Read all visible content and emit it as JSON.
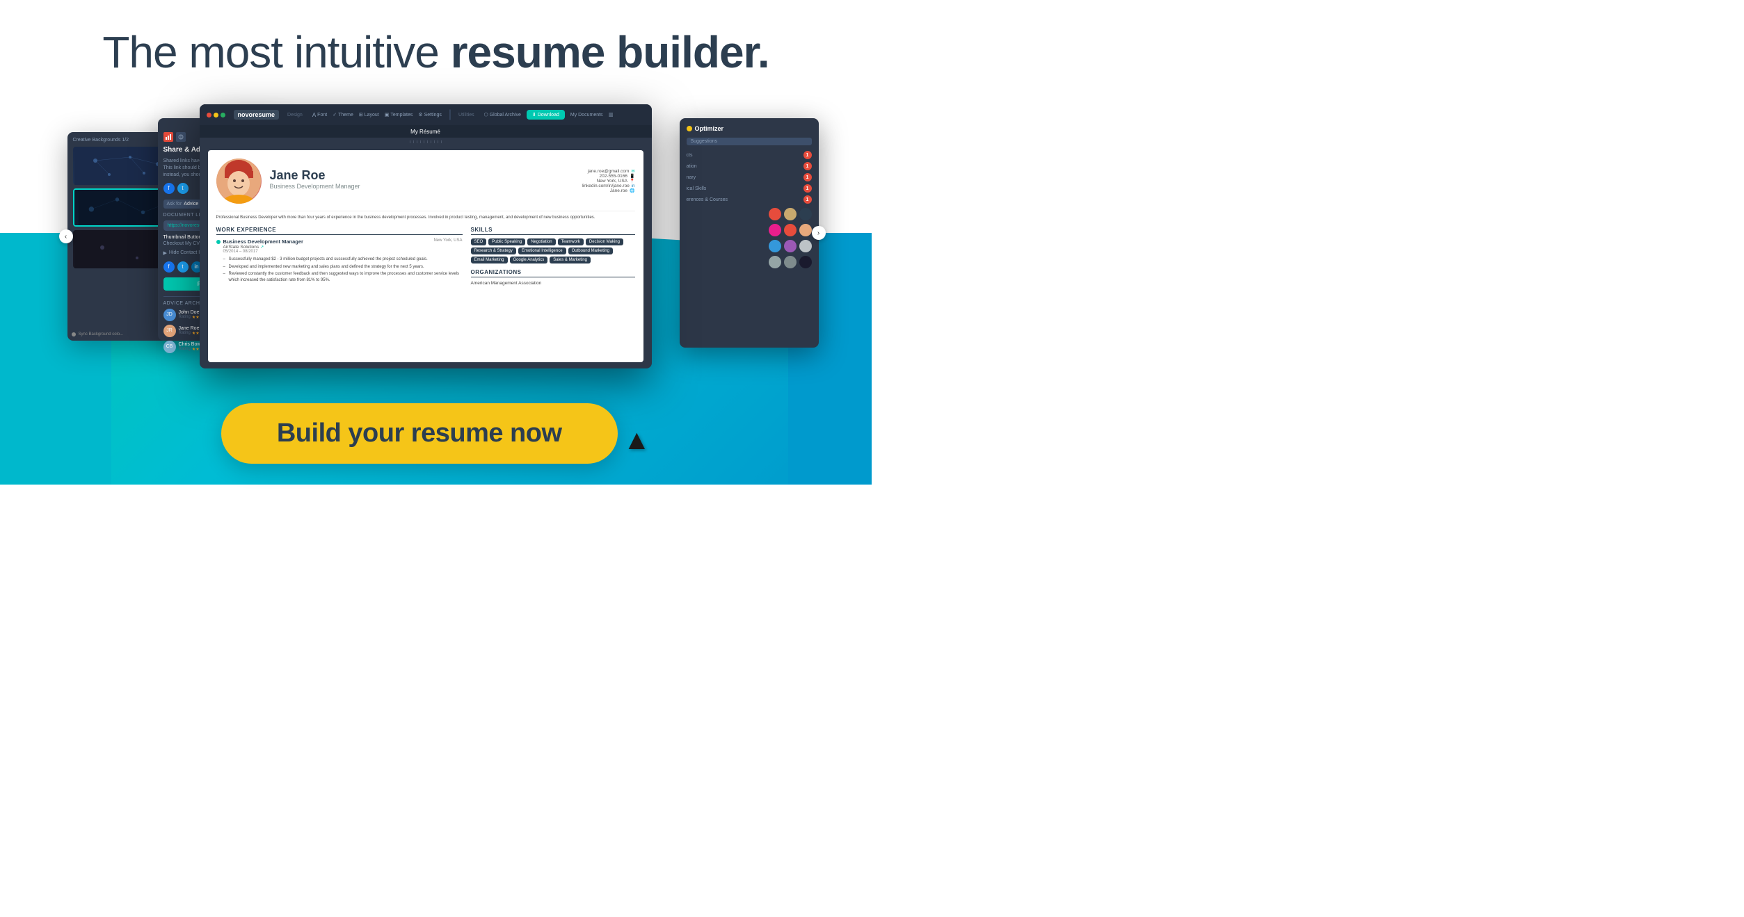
{
  "headline": {
    "part1": "The most intuitive ",
    "part2": "resume builder."
  },
  "cta": {
    "button_label": "Build your resume now"
  },
  "toolbar": {
    "logo": "novoresume",
    "design_label": "Design",
    "utilities_label": "Utilities",
    "font_label": "Font",
    "theme_label": "Theme",
    "layout_label": "Layout",
    "templates_label": "Templates",
    "settings_label": "Settings",
    "global_archive_label": "Global Archive",
    "download_label": "Download",
    "my_documents_label": "My Documents",
    "document_title": "My Résumé"
  },
  "resume": {
    "name": "Jane Roe",
    "title": "Business Development Manager",
    "email": "jane.roe@gmail.com",
    "phone": "202-555-0166",
    "location": "New York, USA",
    "linkedin": "linkedin.com/in/jane.roe",
    "portfolio": "Jane.roe",
    "summary": "Professional Business Developer with more than four years of experience in the business development processes. Involved in product testing, management, and development of new business opportunities.",
    "work_experience_label": "WORK EXPERIENCE",
    "skills_label": "SKILLS",
    "organizations_label": "ORGANIZATIONS",
    "job": {
      "title": "Business Development Manager",
      "company": "AirState Solutions",
      "dates": "05/2014 – 08/2017",
      "location": "New York, USA",
      "bullets": [
        "Successfully managed $2 - 3 million budget projects and successfully achieved the project scheduled goals.",
        "Developed and implemented new marketing and sales plans and defined the strategy for the next 5 years.",
        "Reviewed constantly the customer feedback and then suggested ways to improve the processes and customer service levels which increased the satisfaction rate from 81% to 95%."
      ]
    },
    "skills": [
      "SEO",
      "Public Speaking",
      "Negotiation",
      "Teamwork",
      "Decision Making",
      "Research & Strategy",
      "Emotional Intelligence",
      "Outbound Marketing",
      "Email Marketing",
      "Google Analytics",
      "Sales & Marketing"
    ],
    "org": "American Management Association"
  },
  "share_panel": {
    "title": "Share & Advice",
    "note1": "Shared links have no automatic upd...",
    "note2": "This link should be shared with spe...",
    "note3": "instead, you should be the PDF...",
    "document_link_label": "Document Link",
    "link_value": "https://novoresume.com/refler-m...",
    "thumbnail_label": "Thumbnail Button Text",
    "thumbnail_value": "Checkout My CV",
    "hide_contact": "Hide Contact Information",
    "publish_label": "Publish Changes",
    "advice_archive_label": "Advice Archive",
    "advisors": [
      {
        "name": "John Doe",
        "rating": "★★★★★"
      },
      {
        "name": "Jane Roe",
        "rating": "★★★★☆"
      },
      {
        "name": "Chris Bow",
        "rating": "★★★★☆"
      }
    ]
  },
  "bg_panel": {
    "title": "Creative Backgrounds 1/2",
    "sync_label": "Sync Background colo..."
  },
  "optimizer_panel": {
    "title": "Optimizer",
    "suggestions_label": "Suggestions",
    "sections": [
      {
        "name": "cts",
        "count": "1"
      },
      {
        "name": "ation",
        "count": "1"
      },
      {
        "name": "nary",
        "count": "1"
      },
      {
        "name": "ical Skills",
        "count": "1"
      },
      {
        "name": "erences & Courses",
        "count": "1"
      }
    ],
    "color_palettes": [
      [
        "#e74c3c",
        "#e8a87c",
        "#2c3e50"
      ],
      [
        "#e91e8c",
        "#e74c3c",
        "#e8a87c"
      ],
      [
        "#3498db",
        "#9b59b6",
        "#bdc3c7"
      ],
      [
        "#95a5a6",
        "#7f8c8d",
        "#2c3e50"
      ]
    ]
  }
}
